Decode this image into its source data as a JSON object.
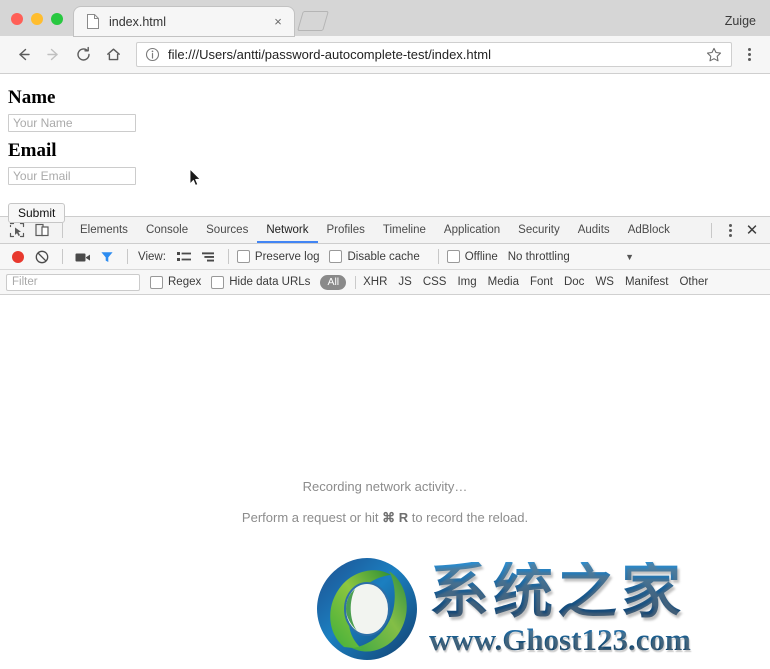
{
  "window": {
    "profile_name": "Zuige",
    "traffic_lights": [
      "close-red",
      "minimize-yellow",
      "maximize-green"
    ]
  },
  "tab": {
    "title": "index.html",
    "favicon": "document-icon",
    "close_label": "×",
    "new_tab_label": "+"
  },
  "toolbar": {
    "back_label": "←",
    "forward_label": "→",
    "reload_label": "⟳",
    "home_label": "⌂",
    "url": "file:///Users/antti/password-autocomplete-test/index.html",
    "security_icon": "info-circle-icon",
    "bookmark_icon": "star-icon",
    "menu_icon": "kebab-menu-icon"
  },
  "page": {
    "fields": [
      {
        "label": "Name",
        "placeholder": "Your Name",
        "value": ""
      },
      {
        "label": "Email",
        "placeholder": "Your Email",
        "value": ""
      }
    ],
    "submit_label": "Submit",
    "cursor": "mouse-pointer"
  },
  "devtools": {
    "inspect_icon": "inspect-element-icon",
    "device_icon": "device-toolbar-icon",
    "tabs": [
      {
        "label": "Elements",
        "active": false
      },
      {
        "label": "Console",
        "active": false
      },
      {
        "label": "Sources",
        "active": false
      },
      {
        "label": "Network",
        "active": true
      },
      {
        "label": "Profiles",
        "active": false
      },
      {
        "label": "Timeline",
        "active": false
      },
      {
        "label": "Application",
        "active": false
      },
      {
        "label": "Security",
        "active": false
      },
      {
        "label": "Audits",
        "active": false
      },
      {
        "label": "AdBlock",
        "active": false
      }
    ],
    "more_icon": "kebab-menu-icon",
    "close_label": "✕",
    "controls": {
      "record_icon": "record-button-icon",
      "clear_icon": "clear-icon",
      "capture_screenshots_icon": "camera-icon",
      "filter_icon": "funnel-icon",
      "view_label": "View:",
      "view_list_icon": "list-view-icon",
      "view_waterfall_icon": "waterfall-view-icon",
      "preserve_log_label": "Preserve log",
      "preserve_log_checked": false,
      "disable_cache_label": "Disable cache",
      "disable_cache_checked": false,
      "offline_label": "Offline",
      "offline_checked": false,
      "throttling_value": "No throttling",
      "throttling_arrow": "▼"
    },
    "filters": {
      "filter_placeholder": "Filter",
      "filter_value": "",
      "regex_label": "Regex",
      "regex_checked": false,
      "hide_data_urls_label": "Hide data URLs",
      "hide_data_urls_checked": false,
      "all_label": "All",
      "types": [
        "XHR",
        "JS",
        "CSS",
        "Img",
        "Media",
        "Font",
        "Doc",
        "WS",
        "Manifest",
        "Other"
      ]
    },
    "empty_state": {
      "line1": "Recording network activity…",
      "line2_prefix": "Perform a request or hit ",
      "line2_key": "⌘ R",
      "line2_suffix": " to record the reload."
    }
  },
  "watermark": {
    "logo_icon": "ghost123-logo-icon",
    "chinese_text": "系统之家",
    "url_text": "www.Ghost123.com"
  },
  "colors": {
    "accent_blue": "#4285f4",
    "record_red": "#e8392e",
    "tabstrip_gray": "#d6d6d6",
    "toolbar_gray": "#f6f6f6"
  }
}
